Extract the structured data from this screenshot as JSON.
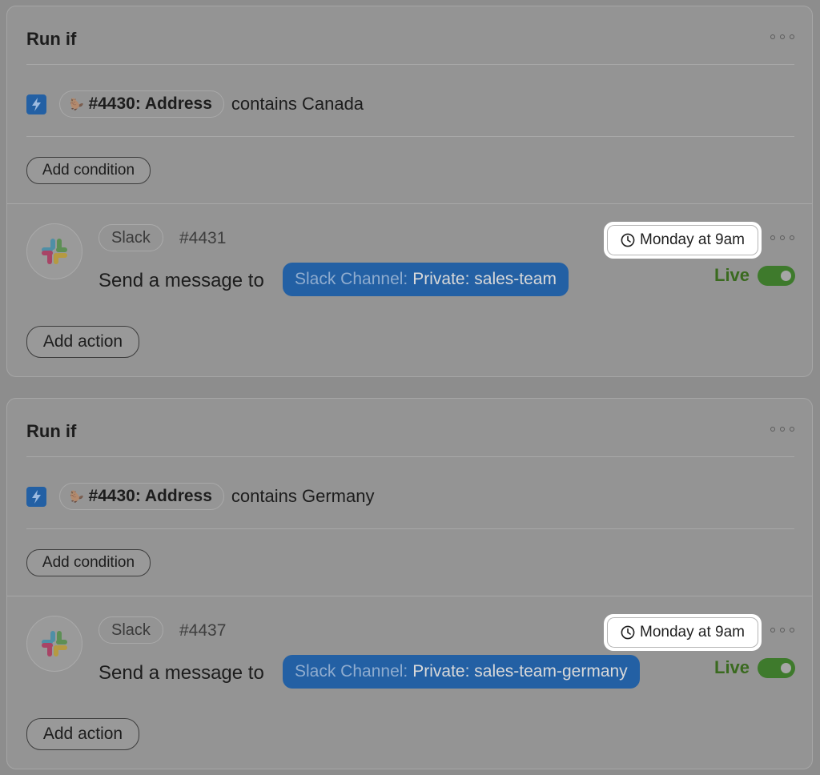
{
  "colors": {
    "channel_chip": "#2360a4",
    "live": "#3a6a1f",
    "toggle_on": "#3e7a2c",
    "bolt": "#2360a4"
  },
  "rules": [
    {
      "title": "Run if",
      "condition": {
        "field": "#4430: Address",
        "operator_value": "contains Canada",
        "field_icon": "beaver-emoji-icon"
      },
      "add_condition_label": "Add condition",
      "action": {
        "app": "Slack",
        "id": "#4431",
        "text": "Send a message to",
        "channel_label": "Slack Channel:",
        "channel_value": "Private: sales-team",
        "schedule": "Monday at 9am",
        "status": "Live",
        "enabled": true
      },
      "add_action_label": "Add action"
    },
    {
      "title": "Run if",
      "condition": {
        "field": "#4430: Address",
        "operator_value": "contains Germany",
        "field_icon": "beaver-emoji-icon"
      },
      "add_condition_label": "Add condition",
      "action": {
        "app": "Slack",
        "id": "#4437",
        "text": "Send a message to",
        "channel_label": "Slack Channel:",
        "channel_value": "Private: sales-team-germany",
        "schedule": "Monday at 9am",
        "status": "Live",
        "enabled": true
      },
      "add_action_label": "Add action"
    }
  ]
}
